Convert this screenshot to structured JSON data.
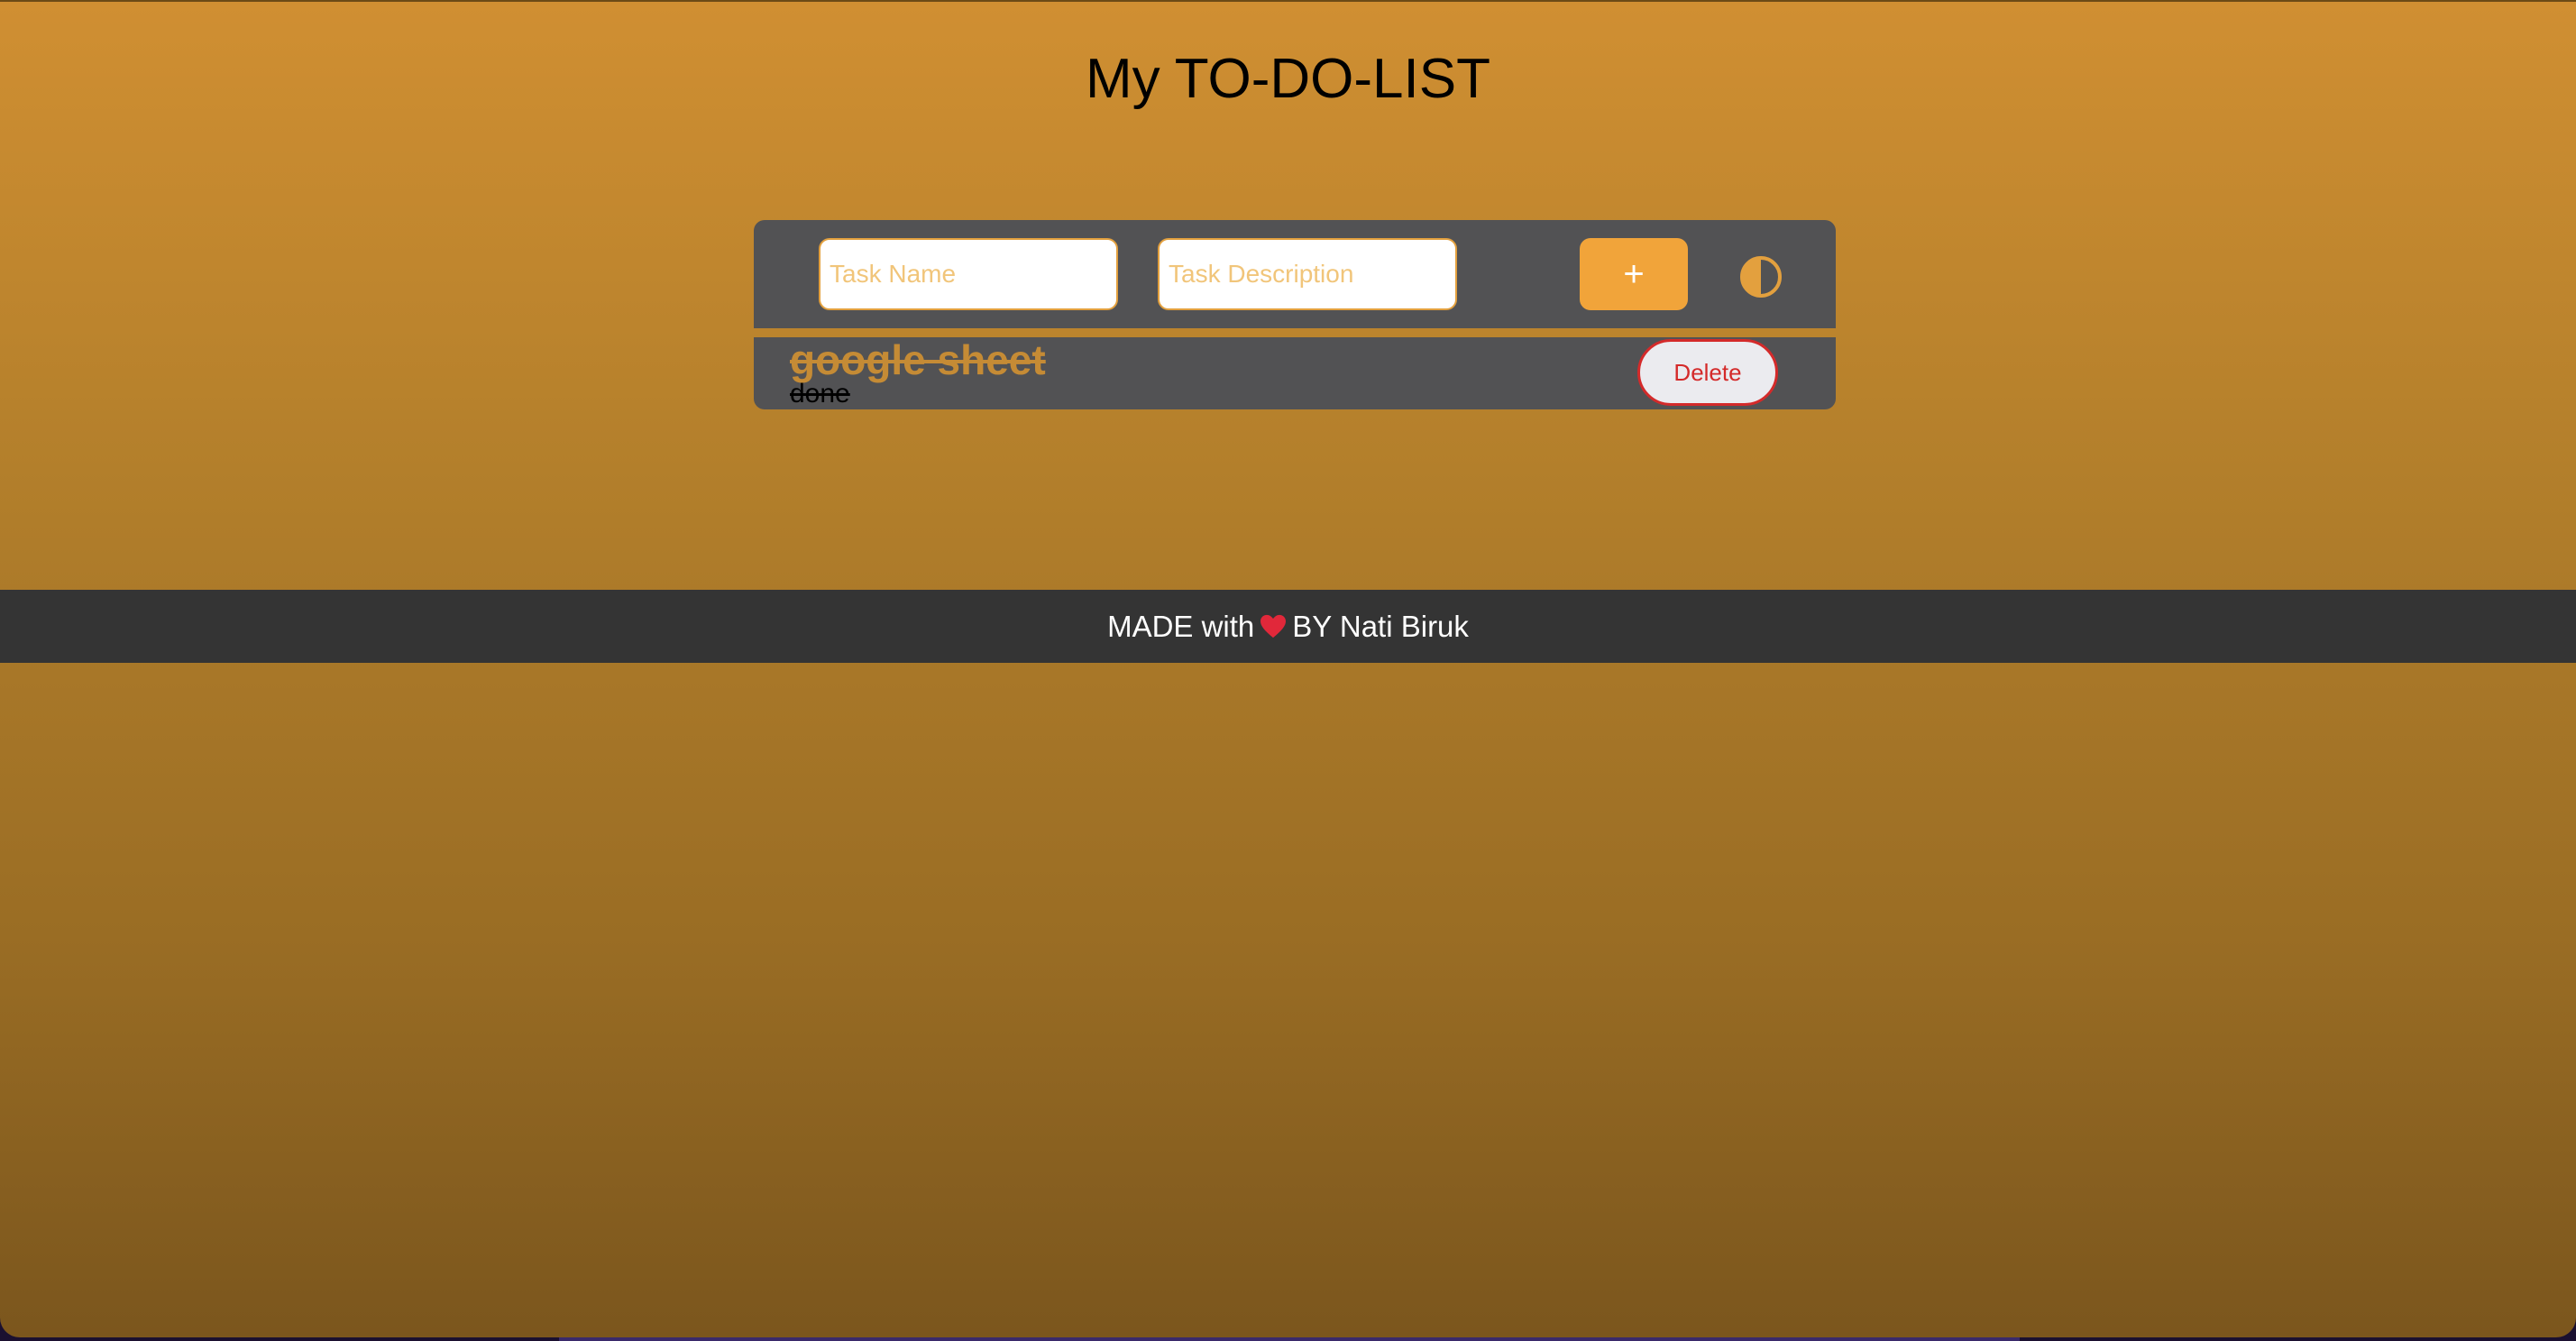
{
  "page": {
    "title": "My TO-DO-LIST"
  },
  "form": {
    "task_name_placeholder": "Task Name",
    "task_description_placeholder": "Task Description",
    "add_label": "+",
    "theme_toggle_icon": "contrast-icon"
  },
  "tasks": [
    {
      "name": "google sheet",
      "description": "done",
      "completed": true,
      "delete_label": "Delete"
    }
  ],
  "footer": {
    "prefix": "MADE with",
    "heart_icon": "heart-icon",
    "suffix": "BY Nati Biruk"
  },
  "colors": {
    "accent": "#f1a43a",
    "card": "#525254",
    "footer": "#343434",
    "delete": "#d42a2a"
  }
}
